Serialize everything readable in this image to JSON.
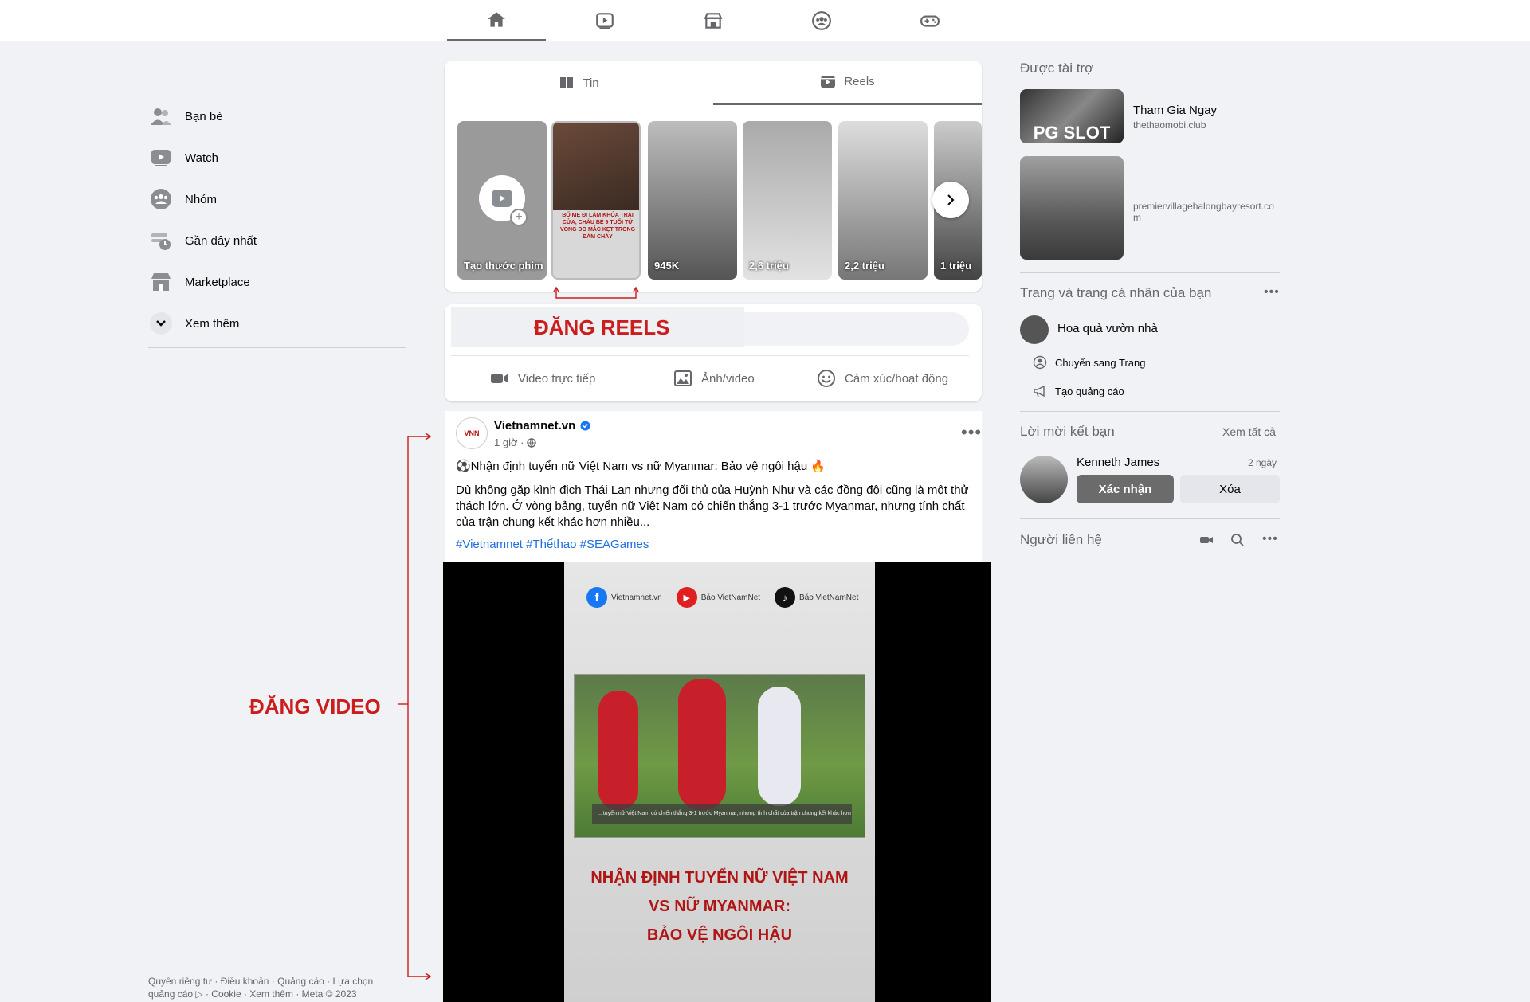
{
  "nav": {
    "tabs": [
      "home-icon",
      "watch-icon",
      "marketplace-icon",
      "groups-icon",
      "gaming-icon"
    ]
  },
  "sidebar": {
    "items": [
      {
        "label": "Bạn bè",
        "icon": "friends-icon"
      },
      {
        "label": "Watch",
        "icon": "watch-icon"
      },
      {
        "label": "Nhóm",
        "icon": "groups-icon"
      },
      {
        "label": "Gần đây nhất",
        "icon": "recent-icon"
      },
      {
        "label": "Marketplace",
        "icon": "marketplace-icon"
      },
      {
        "label": "Xem thêm",
        "icon": "chevron-down-icon"
      }
    ],
    "footer": "Quyền riêng tư · Điều khoản · Quảng cáo · Lựa chọn quảng cáo ▷ · Cookie · Xem thêm · Meta © 2023"
  },
  "stories": {
    "tab_stories": "Tin",
    "tab_reels": "Reels",
    "create_label": "Tạo thước phim",
    "reels": [
      {
        "count": ""
      },
      {
        "count": "945K"
      },
      {
        "count": "2,6 triệu"
      },
      {
        "count": "2,2 triệu"
      },
      {
        "count": "1 triệu"
      }
    ],
    "reel_headline": "BỐ MẸ ĐI LÀM KHÓA TRÁI CỬA, CHÁU BÉ 9 TUỔI TỬ VONG DO MẮC KẸT TRONG ĐÁM CHÁY"
  },
  "annotations": {
    "reels": "ĐĂNG REELS",
    "video": "ĐĂNG VIDEO"
  },
  "composer": {
    "actions": [
      {
        "label": "Video trực tiếp",
        "icon": "live-video-icon"
      },
      {
        "label": "Ảnh/video",
        "icon": "photo-icon"
      },
      {
        "label": "Cảm xúc/hoạt động",
        "icon": "emoji-icon"
      }
    ]
  },
  "post": {
    "author": "Vietnamnet.vn",
    "time": "1 giờ ·",
    "headline": "⚽Nhận định tuyển nữ Việt Nam vs nữ Myanmar: Bảo vệ ngôi hậu 🔥",
    "body": "Dù không gặp kình địch Thái Lan nhưng đối thủ của Huỳnh Như và các đồng đội cũng là một thử thách lớn. Ở vòng bảng, tuyển nữ Việt Nam có chiến thắng 3-1 trước Myanmar, nhưng tính chất của trận chung kết khác hơn nhiều...",
    "hashtags": "#Vietnamnet #Thểthao #SEAGames",
    "video": {
      "socials": [
        "Vietnamnet.vn",
        "Báo VietNamNet",
        "Báo VietNamNet"
      ],
      "caption": "...tuyển nữ Việt Nam có chiến thắng 3-1 trước Myanmar, nhưng tính chất của trận chung kết khác hơn nhiều...",
      "title_lines": [
        "NHẬN ĐỊNH TUYỂN NỮ VIỆT NAM",
        "VS NỮ MYANMAR:",
        "BẢO VỆ NGÔI HẬU"
      ]
    }
  },
  "right": {
    "sponsored_title": "Được tài trợ",
    "ads": [
      {
        "title": "Tham Gia Ngay",
        "domain": "thethaomobi.club",
        "thumb_text": "PG SLOT"
      },
      {
        "title": "",
        "domain": "premiervillagehalongbayresort.com",
        "thumb_text": ""
      }
    ],
    "pages_title": "Trang và trang cá nhân của bạn",
    "page_name": "Hoa quả vườn nhà",
    "switch_label": "Chuyển sang Trang",
    "create_ad_label": "Tạo quảng cáo",
    "requests_title": "Lời mời kết bạn",
    "see_all": "Xem tất cả",
    "request": {
      "name": "Kenneth James",
      "time": "2 ngày",
      "confirm": "Xác nhận",
      "delete": "Xóa"
    },
    "contacts_title": "Người liên hệ"
  },
  "colors": {
    "annotation": "#cc1d1d",
    "link": "#216fdb",
    "verified": "#1877f2"
  }
}
